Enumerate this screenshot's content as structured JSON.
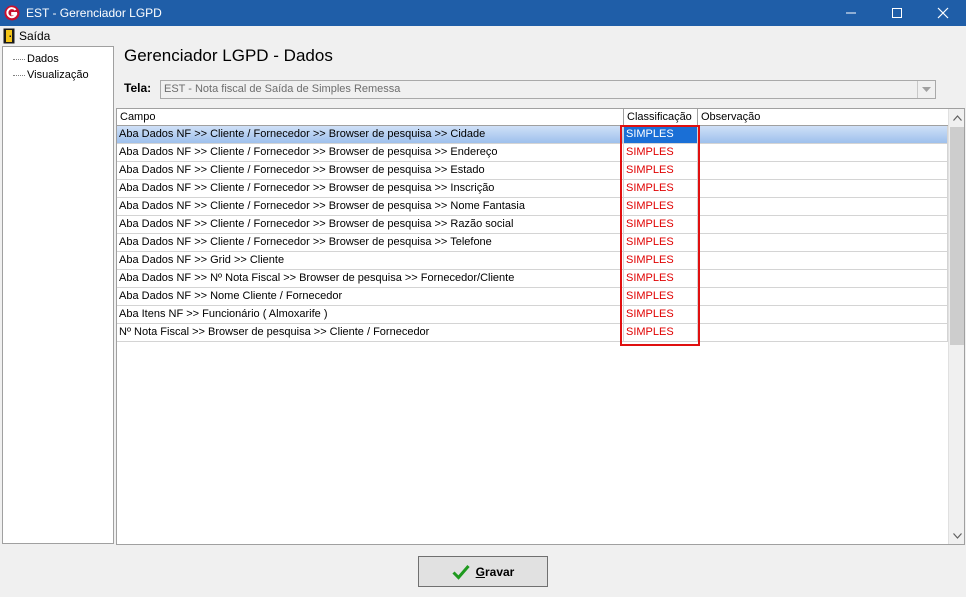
{
  "window": {
    "title": "EST - Gerenciador LGPD"
  },
  "menu": {
    "saida_label": "Saída"
  },
  "tree": {
    "items": [
      {
        "label": "Dados"
      },
      {
        "label": "Visualização"
      }
    ]
  },
  "page": {
    "title": "Gerenciador LGPD - Dados"
  },
  "tela": {
    "label": "Tela:",
    "value": "EST - Nota fiscal de Saída de Simples Remessa"
  },
  "grid": {
    "columns": [
      "Campo",
      "Classificação",
      "Observação"
    ],
    "rows": [
      {
        "campo": "Aba Dados NF >> Cliente / Fornecedor >> Browser de pesquisa >> Cidade",
        "classificacao": "SIMPLES",
        "observacao": ""
      },
      {
        "campo": "Aba Dados NF >> Cliente / Fornecedor >> Browser de pesquisa >> Endereço",
        "classificacao": "SIMPLES",
        "observacao": ""
      },
      {
        "campo": "Aba Dados NF >> Cliente / Fornecedor >> Browser de pesquisa >> Estado",
        "classificacao": "SIMPLES",
        "observacao": ""
      },
      {
        "campo": "Aba Dados NF >> Cliente / Fornecedor >> Browser de pesquisa >> Inscrição",
        "classificacao": "SIMPLES",
        "observacao": ""
      },
      {
        "campo": "Aba Dados NF >> Cliente / Fornecedor >> Browser de pesquisa >> Nome Fantasia",
        "classificacao": "SIMPLES",
        "observacao": ""
      },
      {
        "campo": "Aba Dados NF >> Cliente / Fornecedor >> Browser de pesquisa >> Razão social",
        "classificacao": "SIMPLES",
        "observacao": ""
      },
      {
        "campo": "Aba Dados NF >> Cliente / Fornecedor >> Browser de pesquisa >> Telefone",
        "classificacao": "SIMPLES",
        "observacao": ""
      },
      {
        "campo": "Aba Dados NF >> Grid  >> Cliente",
        "classificacao": "SIMPLES",
        "observacao": ""
      },
      {
        "campo": "Aba Dados NF >> Nº Nota Fiscal >> Browser de pesquisa >> Fornecedor/Cliente",
        "classificacao": "SIMPLES",
        "observacao": ""
      },
      {
        "campo": "Aba Dados NF >> Nome Cliente / Fornecedor",
        "classificacao": "SIMPLES",
        "observacao": ""
      },
      {
        "campo": "Aba Itens NF >> Funcionário ( Almoxarife )",
        "classificacao": "SIMPLES",
        "observacao": ""
      },
      {
        "campo": "Nº Nota Fiscal >> Browser de pesquisa >> Cliente / Fornecedor",
        "classificacao": "SIMPLES",
        "observacao": ""
      }
    ]
  },
  "buttons": {
    "gravar_first": "G",
    "gravar_rest": "ravar"
  },
  "colors": {
    "titlebar": "#1f5ea8",
    "classification_text": "#e00000",
    "selection": "#1a6fd6",
    "highlight_box": "#e01010",
    "check": "#1f9a1f"
  },
  "icons": {
    "app": "app-logo-icon",
    "saida": "exit-door-icon",
    "gravar": "check-icon"
  }
}
